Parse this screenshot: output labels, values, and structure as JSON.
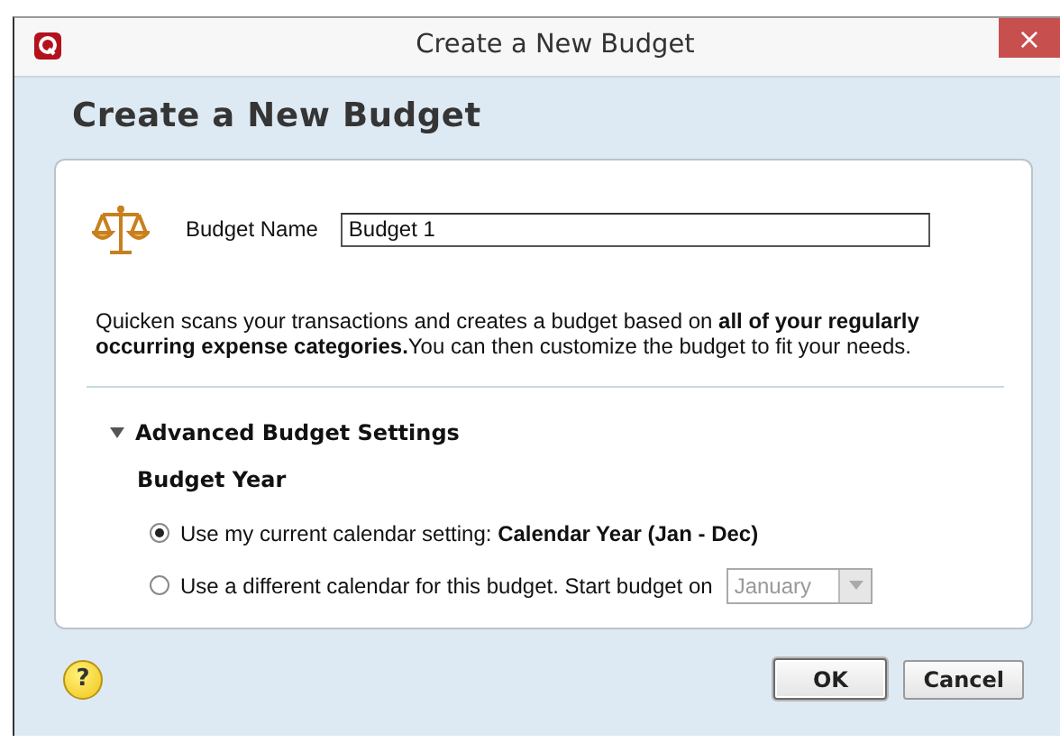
{
  "window": {
    "title": "Create a New Budget",
    "close": "×"
  },
  "heading": "Create a New Budget",
  "budget_name": {
    "label": "Budget Name",
    "value": "Budget 1"
  },
  "description": "Quicken scans your transactions and creates a budget based on **all of your regularly occurring expense categories.**You can then customize the budget to fit your needs.",
  "advanced": {
    "label": "Advanced Budget Settings",
    "expanded": true
  },
  "budget_year": {
    "label": "Budget Year",
    "options": [
      {
        "label": "Use my current calendar setting: **Calendar Year (Jan - Dec)**",
        "selected": true
      },
      {
        "label": "Use a different calendar for this budget. Start budget on",
        "selected": false
      }
    ],
    "start_month": {
      "value": "January",
      "disabled": true
    }
  },
  "help": "?",
  "buttons": [
    {
      "label": "OK",
      "default": true
    },
    {
      "label": "Cancel",
      "default": false
    }
  ]
}
